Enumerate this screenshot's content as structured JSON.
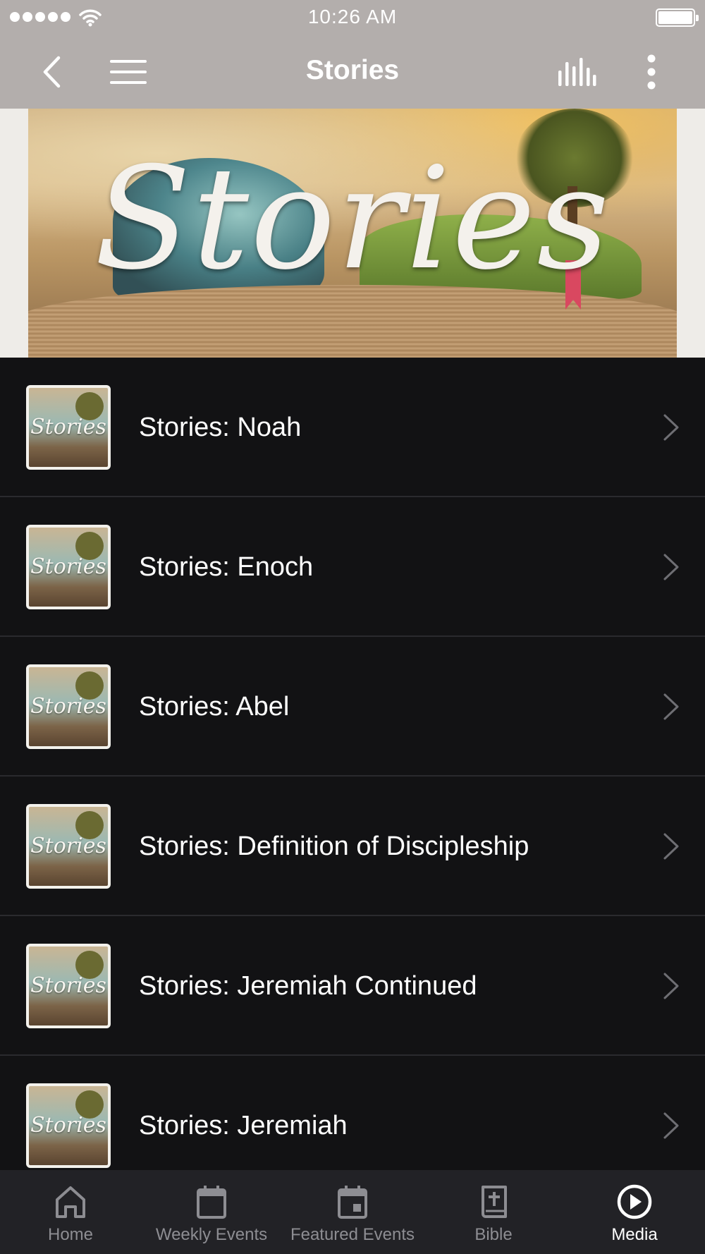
{
  "status_bar": {
    "time": "10:26 AM"
  },
  "nav_bar": {
    "title": "Stories"
  },
  "banner": {
    "word": "Stories"
  },
  "items": [
    {
      "title": "Stories: Noah",
      "thumb_word": "Stories"
    },
    {
      "title": "Stories: Enoch",
      "thumb_word": "Stories"
    },
    {
      "title": "Stories: Abel",
      "thumb_word": "Stories"
    },
    {
      "title": "Stories: Definition of Discipleship",
      "thumb_word": "Stories"
    },
    {
      "title": "Stories: Jeremiah Continued",
      "thumb_word": "Stories"
    },
    {
      "title": "Stories: Jeremiah",
      "thumb_word": "Stories"
    }
  ],
  "tabs": [
    {
      "label": "Home",
      "icon": "home-icon"
    },
    {
      "label": "Weekly Events",
      "icon": "calendar-icon"
    },
    {
      "label": "Featured Events",
      "icon": "calendar-event-icon"
    },
    {
      "label": "Bible",
      "icon": "bible-icon"
    },
    {
      "label": "Media",
      "icon": "play-circle-icon",
      "active": true
    }
  ],
  "colors": {
    "header": "#b3aeac",
    "list_background": "#121214",
    "tab_bar": "#222226",
    "tab_inactive": "#8d8d92",
    "tab_active": "#ffffff"
  }
}
